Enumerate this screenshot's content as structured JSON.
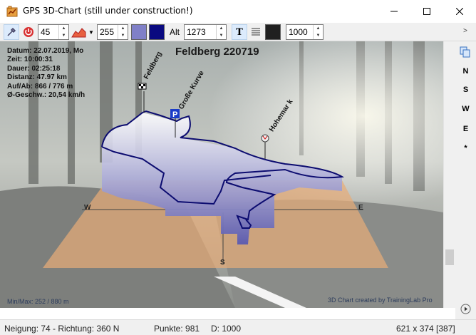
{
  "window": {
    "title": "GPS 3D-Chart (still under construction!)",
    "controls": [
      "minimize",
      "maximize",
      "close"
    ]
  },
  "toolbar": {
    "tilt_value": "45",
    "color_value": "255",
    "alt_label": "Alt",
    "alt_value": "1273",
    "points_value": "1000",
    "color1": "#8080c8",
    "color2": "#0a0a80",
    "color3": "#202020"
  },
  "chart": {
    "title": "Feldberg 220719",
    "info": {
      "datum": "Datum: 22.07.2019, Mo",
      "zeit": "Zeit: 10:00:31",
      "dauer": "Dauer: 02:25:18",
      "distanz": "Distanz: 47.97 km",
      "aufab": "Auf/Ab: 866 / 776 m",
      "geschw": "Ø-Geschw.: 20,54 km/h"
    },
    "labels": {
      "feldberg": "Feldberg",
      "kurve": "Große Kurve",
      "hohemark": "Hohemar k"
    },
    "compass": {
      "w": "W",
      "e": "E",
      "s": "S"
    },
    "minmax": "Min/Max: 252 / 880 m",
    "credit": "3D Chart created by TrainingLab Pro"
  },
  "side": {
    "n": "N",
    "s": "S",
    "w": "W",
    "e": "E",
    "star": "*"
  },
  "status": {
    "neigung": "Neigung: 74 - Richtung: 360 N",
    "punkte": "Punkte: 981",
    "d": "D: 1000",
    "size": "621 x 374 [387]"
  }
}
